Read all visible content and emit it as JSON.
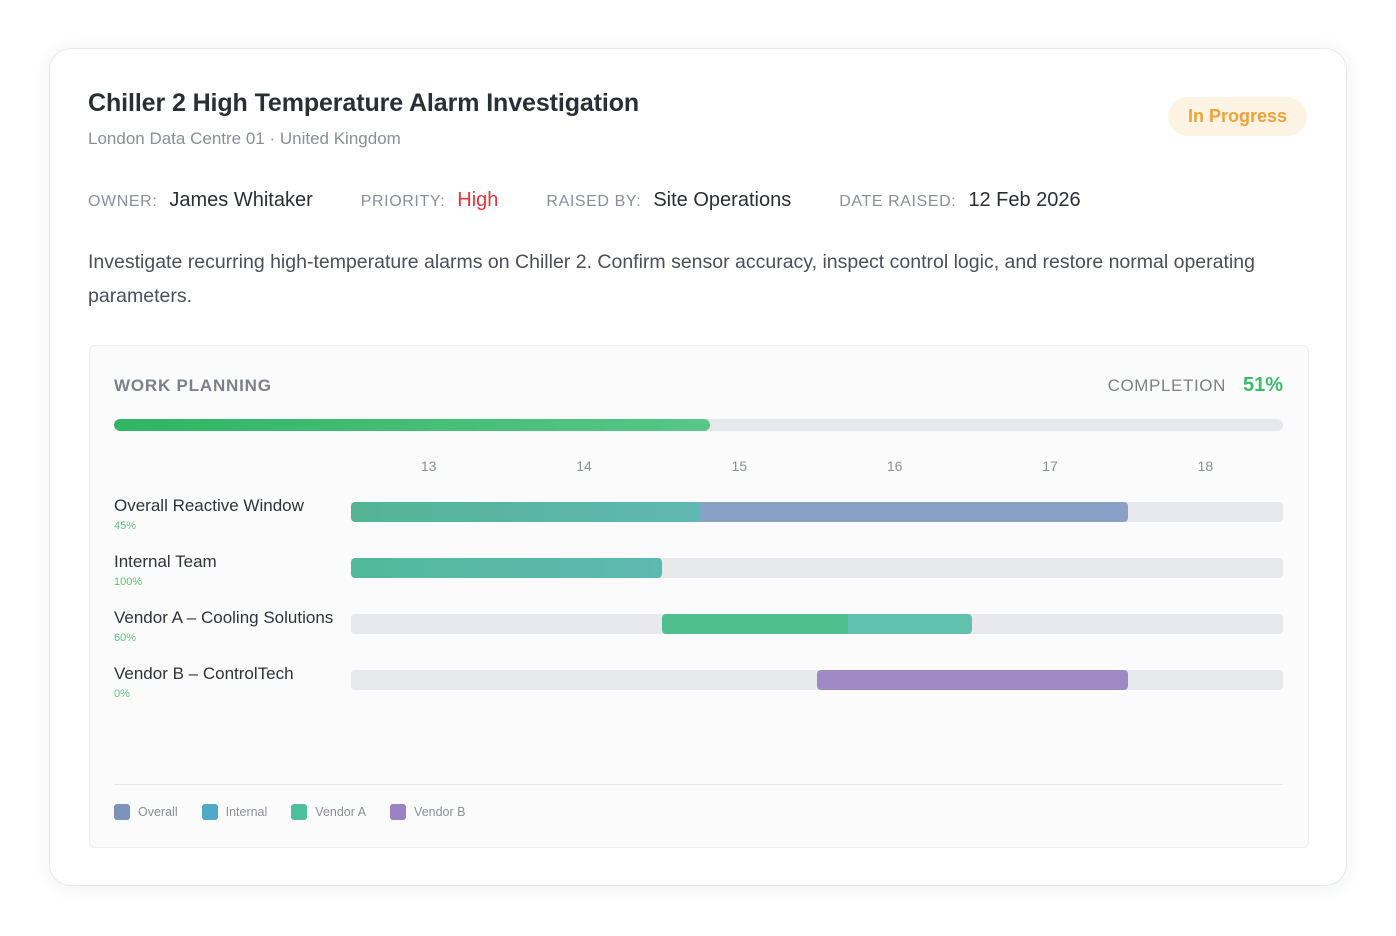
{
  "task": {
    "title": "Chiller 2 High Temperature Alarm Investigation",
    "location": "London Data Centre 01 · United Kingdom",
    "status": "In Progress",
    "meta": {
      "owner_label": "OWNER:",
      "owner": "James Whitaker",
      "priority_label": "PRIORITY:",
      "priority": "High",
      "raised_by_label": "RAISED BY:",
      "raised_by": "Site Operations",
      "date_label": "DATE RAISED:",
      "date": "12 Feb 2026"
    },
    "description": "Investigate recurring high-temperature alarms on Chiller 2. Confirm sensor accuracy, inspect control logic, and restore normal operating parameters."
  },
  "planning": {
    "title": "WORK PLANNING",
    "completion_label": "COMPLETION",
    "completion_value": "51%",
    "completion_fraction": 0.51
  },
  "chart_data": {
    "type": "gantt",
    "x_ticks": [
      "13",
      "14",
      "15",
      "16",
      "17",
      "18"
    ],
    "x_range": [
      12.5,
      18.5
    ],
    "rows": [
      {
        "name": "Overall Reactive Window",
        "progress_label": "45%",
        "progress": 0.45,
        "start": 12.5,
        "end": 17.5,
        "series": "Overall"
      },
      {
        "name": "Internal Team",
        "progress_label": "100%",
        "progress": 1.0,
        "start": 12.5,
        "end": 14.5,
        "series": "Internal"
      },
      {
        "name": "Vendor A – Cooling Solutions",
        "progress_label": "60%",
        "progress": 0.6,
        "start": 14.5,
        "end": 16.5,
        "series": "Vendor A"
      },
      {
        "name": "Vendor B – ControlTech",
        "progress_label": "0%",
        "progress": 0.0,
        "start": 15.5,
        "end": 17.5,
        "series": "Vendor B"
      }
    ],
    "legend": [
      {
        "label": "Overall",
        "color": "#7b93bd"
      },
      {
        "label": "Internal",
        "color": "#4fa9c9"
      },
      {
        "label": "Vendor A",
        "color": "#4dbf9a"
      },
      {
        "label": "Vendor B",
        "color": "#9a83c2"
      }
    ],
    "colors": {
      "progress_done": "#55b394",
      "overall": "#8aa1c6",
      "internal_start": "#52b99a",
      "internal_end": "#5fb8b2",
      "vendor_a_start": "#4fc08d",
      "vendor_a_end": "#62c2b0",
      "vendor_b": "#9e89c4"
    }
  }
}
